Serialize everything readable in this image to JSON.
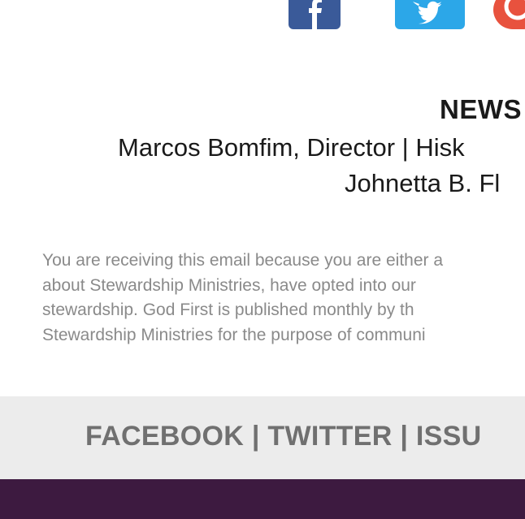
{
  "social": {
    "icons": [
      "facebook-icon",
      "twitter-icon",
      "pinterest-icon"
    ],
    "colors": {
      "facebook": "#3a5a99",
      "twitter": "#2ca7e8",
      "pinterest": "#e8523e"
    }
  },
  "newsletter": {
    "title": "NEWS",
    "credit_line1": "Marcos Bomfim, Director | Hisk",
    "credit_line2": "Johnetta B. Fl"
  },
  "disclaimer": {
    "lines": [
      "You are receiving this email because you are either a",
      "about Stewardship Ministries, have opted into our",
      "stewardship. God First is published monthly by th",
      "Stewardship Ministries for the purpose of communi"
    ]
  },
  "footer": {
    "links": [
      "FACEBOOK",
      "TWITTER",
      "ISSU"
    ],
    "separator": "|",
    "bg_color": "#ececec",
    "bottom_bar_color": "#3d1a40"
  }
}
